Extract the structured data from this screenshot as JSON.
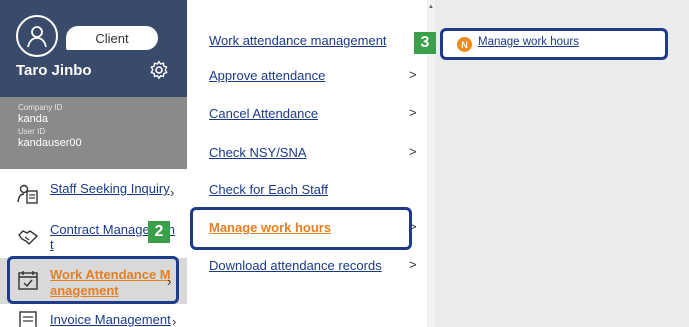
{
  "profile": {
    "role_tag": "Client",
    "name": "Taro Jinbo"
  },
  "info": {
    "company_id_label": "Company ID",
    "company_id": "kanda",
    "user_id_label": "User ID",
    "user_id": "kandauser00"
  },
  "sidebar": {
    "items": [
      {
        "label": "Staff Seeking Inquiry",
        "icon": "staff-doc-icon"
      },
      {
        "label_1": "Contract Managemen",
        "label_2": "t",
        "icon": "handshake-icon"
      },
      {
        "label_1": "Work Attendance M",
        "label_2": "anagement",
        "icon": "calendar-check-icon"
      },
      {
        "label": "Invoice Management",
        "icon": "invoice-icon"
      }
    ]
  },
  "menu": {
    "items": [
      {
        "label": "Work attendance management",
        "chevron": ""
      },
      {
        "label": "Approve attendance",
        "chevron": ">"
      },
      {
        "label": "Cancel Attendance",
        "chevron": ">"
      },
      {
        "label": "Check NSY/SNA",
        "chevron": ">"
      },
      {
        "label": "Check for Each Staff",
        "chevron": ""
      },
      {
        "label": "Manage work hours",
        "chevron": ">"
      },
      {
        "label": "Download attendance records",
        "chevron": ">"
      }
    ]
  },
  "submenu": {
    "badge_letter": "N",
    "label": "Manage work hours"
  },
  "callouts": {
    "step2": "2",
    "step3": "3"
  },
  "colors": {
    "profile_bg": "#3a4a6b",
    "info_bg": "#8a8a8a",
    "link": "#1a3a8a",
    "active_orange": "#e67e22",
    "highlight_border": "#1f3a8a",
    "badge_green": "#3aa04a",
    "panel_bg": "#ebebeb"
  }
}
